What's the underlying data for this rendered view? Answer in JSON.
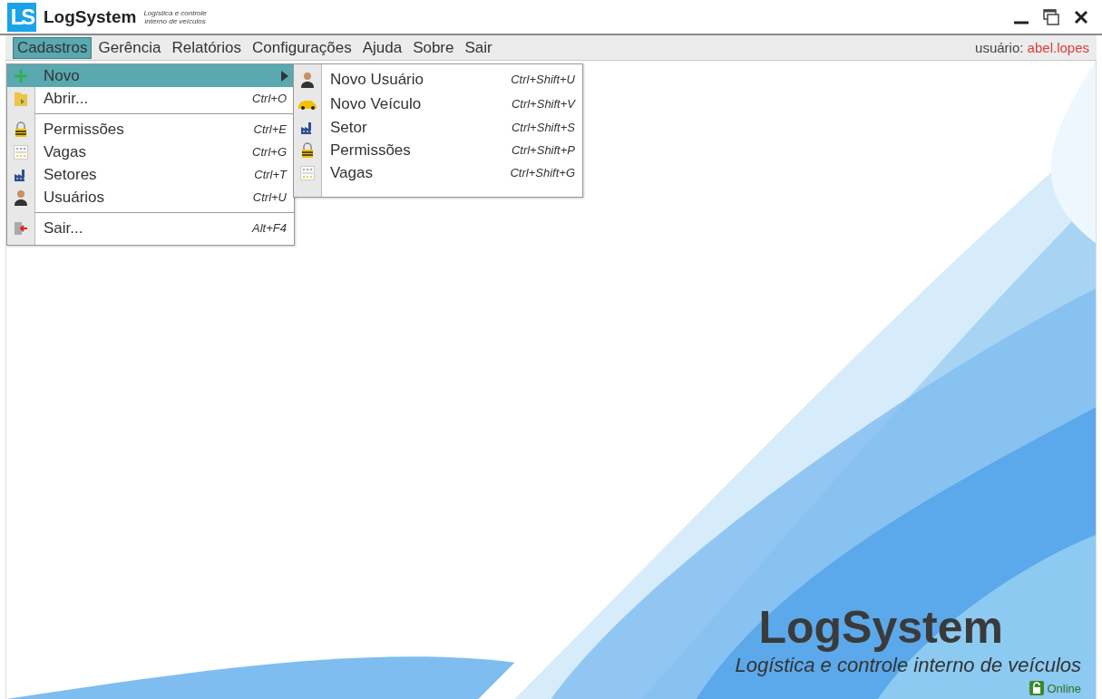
{
  "window": {
    "logo": "LS",
    "title": "LogSystem",
    "subtitle_lines": [
      "Logística e controle",
      "interno de veículos"
    ]
  },
  "menu_bar": {
    "items": [
      {
        "label": "Cadastros",
        "selected": true
      },
      {
        "label": "Gerência",
        "selected": false
      },
      {
        "label": "Relatórios",
        "selected": false
      },
      {
        "label": "Configurações",
        "selected": false
      },
      {
        "label": "Ajuda",
        "selected": false
      },
      {
        "label": "Sobre",
        "selected": false
      },
      {
        "label": "Sair",
        "selected": false
      }
    ],
    "user_label": "usuário:",
    "user_name": "abel.lopes"
  },
  "dropdown": {
    "groups": [
      [
        {
          "label": "Novo",
          "kind": "plus",
          "submenu": true,
          "selected": true
        },
        {
          "label": "Abrir...",
          "kind": "folder",
          "shortcut": "Ctrl+O",
          "selected": false
        }
      ],
      [
        {
          "label": "Permissões",
          "kind": "lock",
          "shortcut": "Ctrl+E",
          "selected": false
        },
        {
          "label": "Vagas",
          "kind": "slots",
          "shortcut": "Ctrl+G",
          "selected": false
        },
        {
          "label": "Setores",
          "kind": "factory",
          "shortcut": "Ctrl+T",
          "selected": false
        },
        {
          "label": "Usuários",
          "kind": "user",
          "shortcut": "Ctrl+U",
          "selected": false
        }
      ],
      [
        {
          "label": "Sair...",
          "kind": "exit",
          "shortcut": "Alt+F4",
          "selected": false
        }
      ]
    ]
  },
  "submenu": {
    "items": [
      {
        "label": "Novo Usuário",
        "kind": "user",
        "shortcut": "Ctrl+Shift+U"
      },
      {
        "label": "Novo Veículo",
        "kind": "car",
        "shortcut": "Ctrl+Shift+V"
      },
      {
        "label": "Setor",
        "kind": "factory",
        "shortcut": "Ctrl+Shift+S"
      },
      {
        "label": "Permissões",
        "kind": "lock",
        "shortcut": "Ctrl+Shift+P"
      },
      {
        "label": "Vagas",
        "kind": "slots",
        "shortcut": "Ctrl+Shift+G"
      }
    ]
  },
  "splash": {
    "title": "LogSystem",
    "tagline": "Logística e controle interno de veículos"
  },
  "status": {
    "label": "Online",
    "online": true
  }
}
